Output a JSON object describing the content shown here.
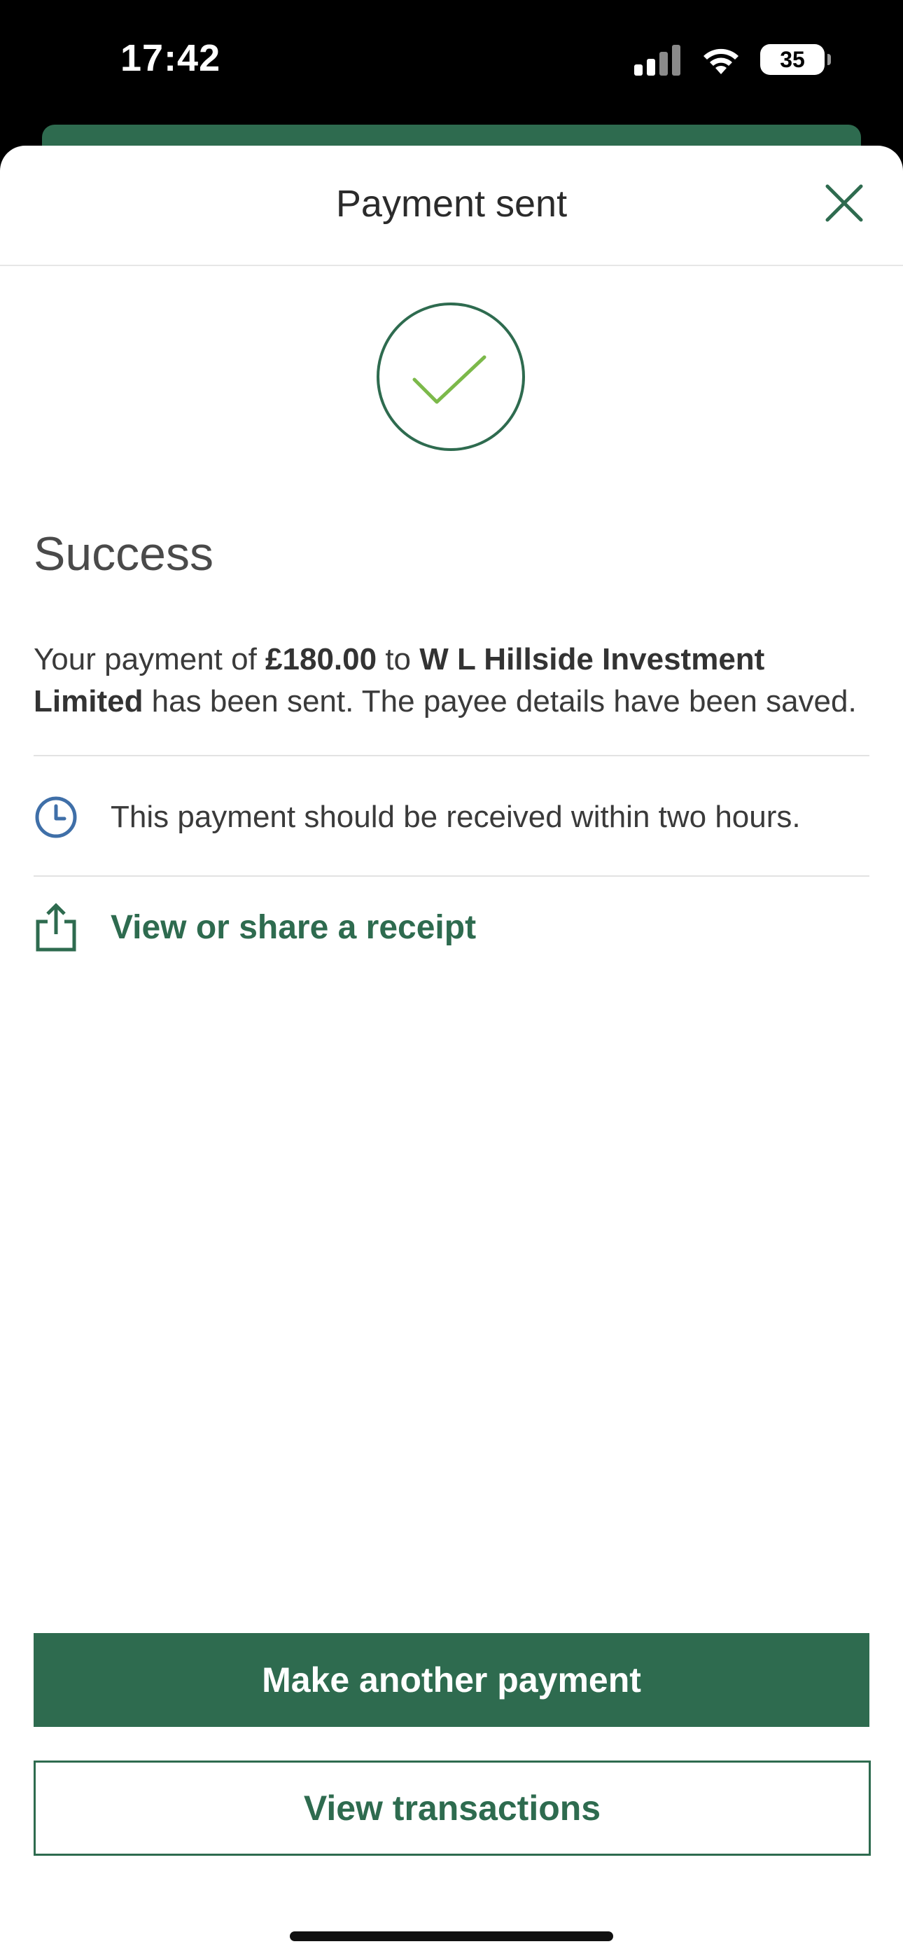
{
  "status_bar": {
    "time": "17:42",
    "battery": "35",
    "icons": [
      "signal-icon",
      "wifi-icon",
      "battery-icon"
    ]
  },
  "header": {
    "title": "Payment sent",
    "close_icon": "close-icon"
  },
  "success": {
    "icon": "checkmark-circle-icon",
    "heading": "Success",
    "message": {
      "prefix": "Your payment of ",
      "amount": "£180.00",
      "middle": " to ",
      "payee": "W L Hillside Investment Limited",
      "suffix": " has been sent. The payee details have been saved."
    }
  },
  "info": {
    "icon": "clock-icon",
    "text": "This payment should be received within two hours."
  },
  "receipt": {
    "icon": "share-icon",
    "label": "View or share a receipt"
  },
  "actions": {
    "primary_label": "Make another payment",
    "secondary_label": "View transactions"
  },
  "colors": {
    "brand_green": "#2e6b4f",
    "check_green": "#7cb94a",
    "clock_blue": "#3f6fa8"
  }
}
